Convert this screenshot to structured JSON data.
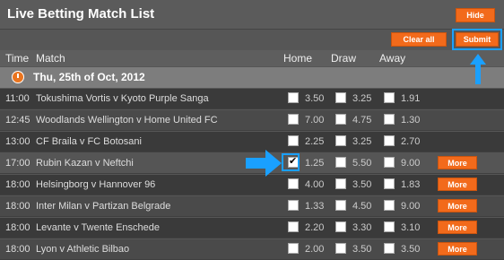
{
  "header": {
    "title": "Live Betting Match List",
    "hide_label": "Hide",
    "clear_label": "Clear all",
    "submit_label": "Submit"
  },
  "columns": {
    "time": "Time",
    "match": "Match",
    "home": "Home",
    "draw": "Draw",
    "away": "Away"
  },
  "date_label": "Thu, 25th of Oct, 2012",
  "more_label": "More",
  "matches": [
    {
      "time": "11:00",
      "match": "Tokushima Vortis v Kyoto Purple Sanga",
      "home": "3.50",
      "draw": "3.25",
      "away": "1.91",
      "checked": false,
      "more": false
    },
    {
      "time": "12:45",
      "match": "Woodlands Wellington v Home United FC",
      "home": "7.00",
      "draw": "4.75",
      "away": "1.30",
      "checked": false,
      "more": false
    },
    {
      "time": "13:00",
      "match": "CF Braila v FC Botosani",
      "home": "2.25",
      "draw": "3.25",
      "away": "2.70",
      "checked": false,
      "more": false
    },
    {
      "time": "17:00",
      "match": "Rubin Kazan v Neftchi",
      "home": "1.25",
      "draw": "5.50",
      "away": "9.00",
      "checked": true,
      "more": true
    },
    {
      "time": "18:00",
      "match": "Helsingborg v Hannover 96",
      "home": "4.00",
      "draw": "3.50",
      "away": "1.83",
      "checked": false,
      "more": true
    },
    {
      "time": "18:00",
      "match": "Inter Milan v Partizan Belgrade",
      "home": "1.33",
      "draw": "4.50",
      "away": "9.00",
      "checked": false,
      "more": true
    },
    {
      "time": "18:00",
      "match": "Levante v Twente Enschede",
      "home": "2.20",
      "draw": "3.30",
      "away": "3.10",
      "checked": false,
      "more": true
    },
    {
      "time": "18:00",
      "match": "Lyon v Athletic Bilbao",
      "home": "2.00",
      "draw": "3.50",
      "away": "3.50",
      "checked": false,
      "more": true
    }
  ],
  "colors": {
    "accent": "#f26a1b",
    "highlight": "#1aa0ff"
  }
}
